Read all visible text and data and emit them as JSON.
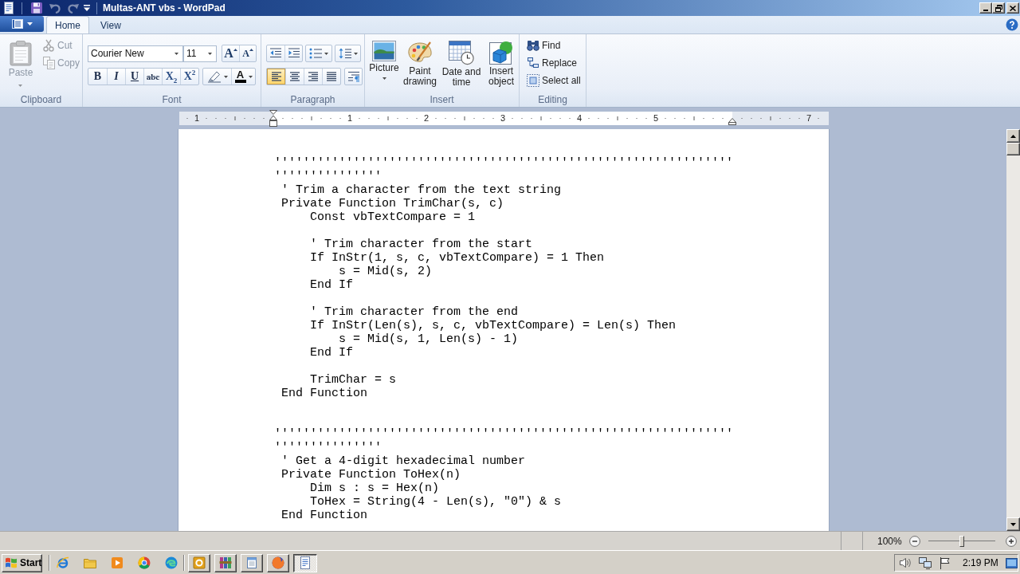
{
  "window": {
    "title": "Multas-ANT vbs - WordPad"
  },
  "quick_access": [
    {
      "kind": "save",
      "disabled": false
    },
    {
      "kind": "undo",
      "disabled": true
    },
    {
      "kind": "redo",
      "disabled": true
    }
  ],
  "ribbon": {
    "tabs": [
      {
        "label": "Home",
        "selected": true
      },
      {
        "label": "View",
        "selected": false
      }
    ],
    "clipboard": {
      "label": "Clipboard",
      "paste": {
        "label": "Paste",
        "disabled": true
      },
      "items": [
        {
          "kind": "cut",
          "label": "Cut",
          "disabled": true
        },
        {
          "kind": "copy",
          "label": "Copy",
          "disabled": true
        }
      ]
    },
    "font": {
      "label": "Font",
      "family": "Courier New",
      "size": "11",
      "size_buttons": [
        {
          "kind": "grow",
          "label": "A"
        },
        {
          "kind": "shrink",
          "label": "A"
        }
      ],
      "format_buttons": [
        {
          "kind": "bold",
          "label": "B"
        },
        {
          "kind": "italic",
          "label": "I"
        },
        {
          "kind": "underline",
          "label": "U"
        },
        {
          "kind": "strikethrough",
          "label": "abc"
        },
        {
          "kind": "subscript",
          "label": "X$_{2}$"
        },
        {
          "kind": "superscript",
          "label": "X$^{2}$"
        }
      ],
      "color_button": {
        "label": "A"
      }
    },
    "paragraph": {
      "label": "Paragraph",
      "alignment": [
        {
          "kind": "left",
          "selected": true
        },
        {
          "kind": "center",
          "selected": false
        },
        {
          "kind": "right",
          "selected": false
        },
        {
          "kind": "justify",
          "selected": false
        }
      ]
    },
    "insert": {
      "label": "Insert",
      "buttons": [
        {
          "kind": "picture",
          "label": "Picture",
          "dropdown": true
        },
        {
          "kind": "paint",
          "label": "Paint drawing",
          "dropdown": false
        },
        {
          "kind": "datetime",
          "label": "Date and time",
          "dropdown": false
        },
        {
          "kind": "object",
          "label": "Insert object",
          "dropdown": false
        }
      ]
    },
    "editing": {
      "label": "Editing",
      "items": [
        {
          "kind": "find",
          "label": "Find"
        },
        {
          "kind": "replace",
          "label": "Replace"
        },
        {
          "kind": "select",
          "label": "Select all"
        }
      ]
    }
  },
  "ruler": {
    "labels": [
      "1",
      "1",
      "2",
      "3",
      "4",
      "5",
      "7"
    ]
  },
  "document": {
    "lines": [
      {
        "kind": "code",
        "text": "''''''''''''''''''''''''''''''''''''''''''''''''''''''''''''''''"
      },
      {
        "kind": "code",
        "text": "'''''''''''''''"
      },
      {
        "kind": "code",
        "text": " ' Trim a character from the text string"
      },
      {
        "kind": "code",
        "text": " Private Function TrimChar(s, c)"
      },
      {
        "kind": "code",
        "text": "     Const vbTextCompare = 1"
      },
      {
        "kind": "blank"
      },
      {
        "kind": "code",
        "text": "     ' Trim character from the start"
      },
      {
        "kind": "code",
        "text": "     If InStr(1, s, c, vbTextCompare) = 1 Then"
      },
      {
        "kind": "code",
        "text": "         s = Mid(s, 2)"
      },
      {
        "kind": "code",
        "text": "     End If"
      },
      {
        "kind": "blank"
      },
      {
        "kind": "code",
        "text": "     ' Trim character from the end"
      },
      {
        "kind": "code",
        "text": "     If InStr(Len(s), s, c, vbTextCompare) = Len(s) Then"
      },
      {
        "kind": "code",
        "text": "         s = Mid(s, 1, Len(s) - 1)"
      },
      {
        "kind": "code",
        "text": "     End If"
      },
      {
        "kind": "blank"
      },
      {
        "kind": "code",
        "text": "     TrimChar = s"
      },
      {
        "kind": "code",
        "text": " End Function"
      },
      {
        "kind": "blank"
      },
      {
        "kind": "blank"
      },
      {
        "kind": "code",
        "text": "''''''''''''''''''''''''''''''''''''''''''''''''''''''''''''''''"
      },
      {
        "kind": "code",
        "text": "'''''''''''''''"
      },
      {
        "kind": "code",
        "text": " ' Get a 4-digit hexadecimal number"
      },
      {
        "kind": "code",
        "text": " Private Function ToHex(n)"
      },
      {
        "kind": "code",
        "text": "     Dim s : s = Hex(n)"
      },
      {
        "kind": "code",
        "text": "     ToHex = String(4 - Len(s), \"0\") & s"
      },
      {
        "kind": "code",
        "text": " End Function"
      }
    ]
  },
  "status_bar": {
    "zoom": "100%",
    "zoom_slider": {
      "level": 0.5
    }
  },
  "taskbar": {
    "start": "Start",
    "tasks": [
      {
        "kind": "tile",
        "selected": false
      },
      {
        "kind": "archive",
        "selected": false
      },
      {
        "kind": "notepad",
        "selected": false
      },
      {
        "kind": "browser",
        "selected": false
      },
      {
        "kind": "document",
        "selected": true
      }
    ],
    "clock": "2:19 PM"
  }
}
